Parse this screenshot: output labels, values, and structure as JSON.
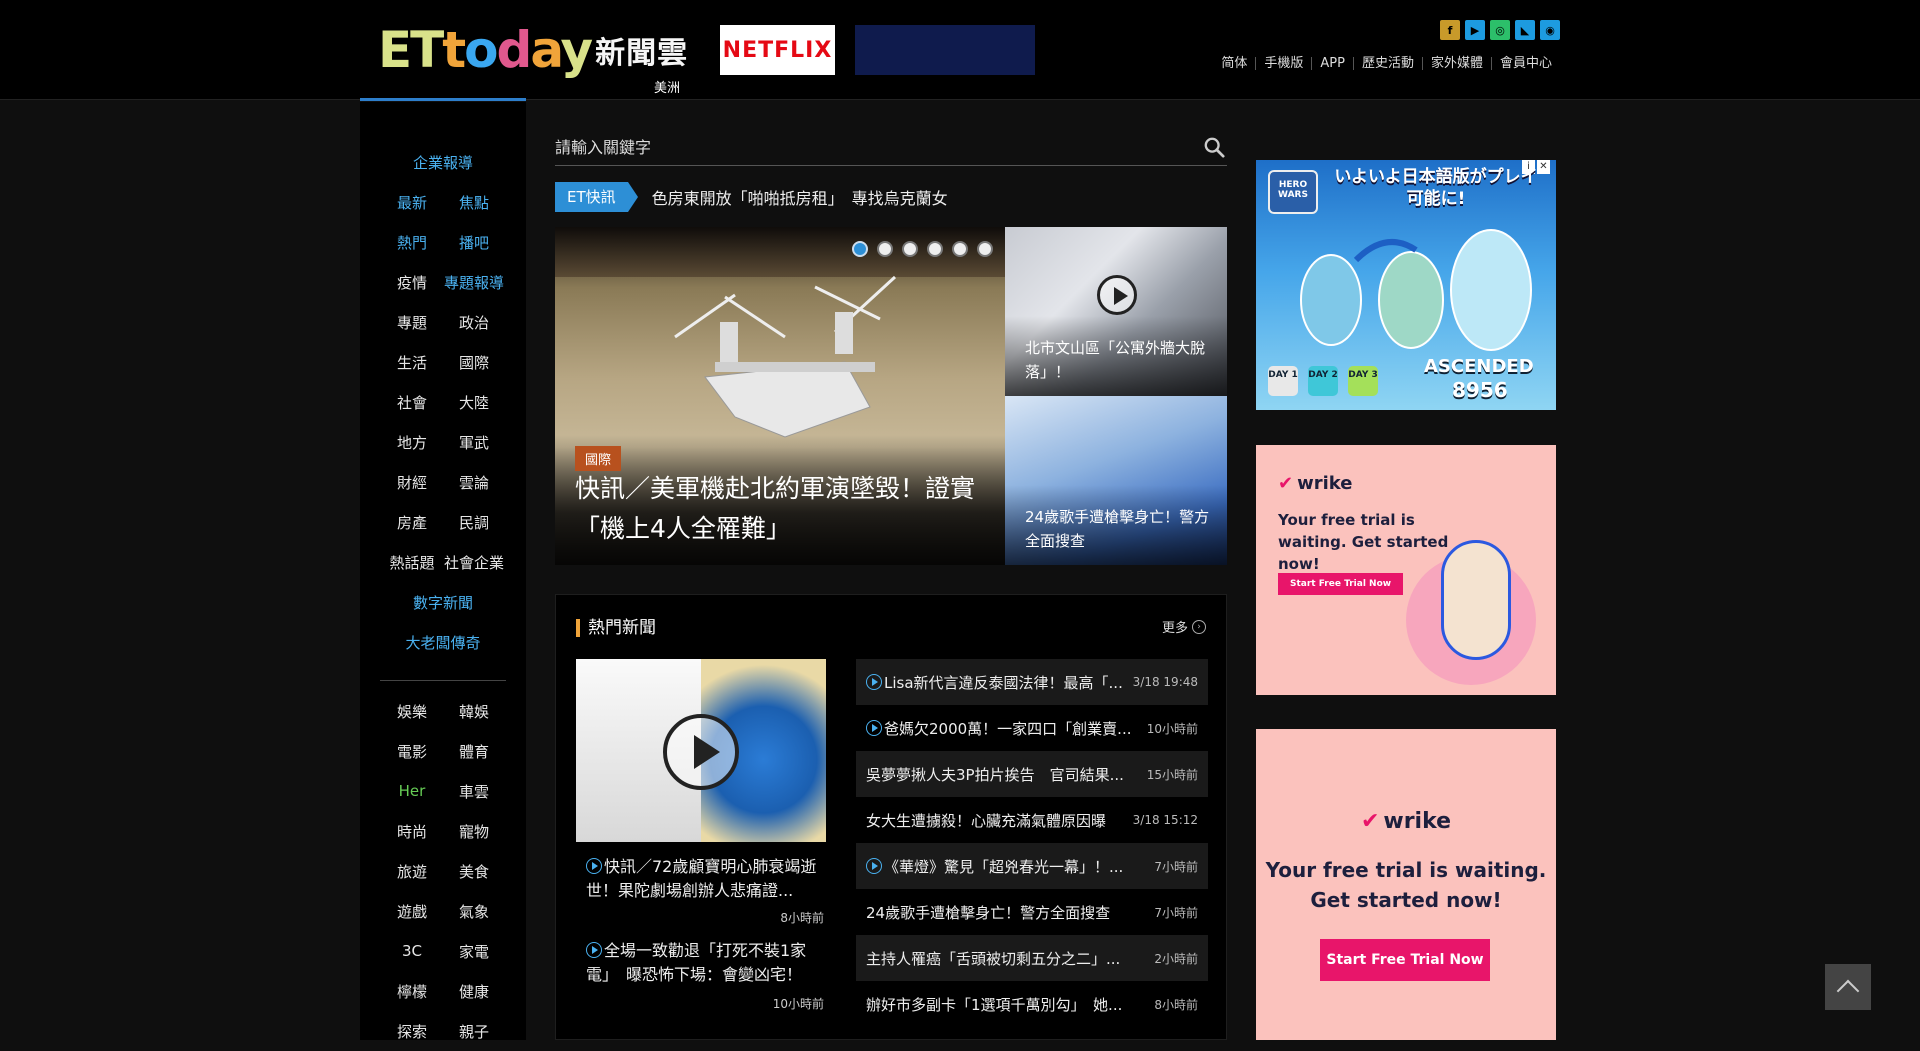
{
  "header": {
    "logo_latin": "ETtoday",
    "logo_cn": "新聞雲",
    "region": "美洲",
    "netflix_label": "NETFLIX",
    "social_icons": [
      "facebook-icon",
      "youtube-icon",
      "instagram-icon",
      "rss-icon",
      "weibo-icon"
    ],
    "topnav": [
      "简体",
      "手機版",
      "APP",
      "歷史活動",
      "家外媒體",
      "會員中心"
    ]
  },
  "leftnav": {
    "rows": [
      [
        {
          "label": "企業報導",
          "color": "blue"
        }
      ],
      [
        {
          "label": "最新",
          "color": "blue"
        },
        {
          "label": "焦點",
          "color": "blue"
        }
      ],
      [
        {
          "label": "熱門",
          "color": "blue"
        },
        {
          "label": "播吧",
          "color": "blue"
        }
      ],
      [
        {
          "label": "疫情",
          "color": "white"
        },
        {
          "label": "專題報導",
          "color": "blue"
        }
      ],
      [
        {
          "label": "專題",
          "color": "white"
        },
        {
          "label": "政治",
          "color": "white"
        }
      ],
      [
        {
          "label": "生活",
          "color": "white"
        },
        {
          "label": "國際",
          "color": "white"
        }
      ],
      [
        {
          "label": "社會",
          "color": "white"
        },
        {
          "label": "大陸",
          "color": "white"
        }
      ],
      [
        {
          "label": "地方",
          "color": "white"
        },
        {
          "label": "軍武",
          "color": "white"
        }
      ],
      [
        {
          "label": "財經",
          "color": "white"
        },
        {
          "label": "雲論",
          "color": "white"
        }
      ],
      [
        {
          "label": "房產",
          "color": "white"
        },
        {
          "label": "民調",
          "color": "white"
        }
      ],
      [
        {
          "label": "熱話題",
          "color": "white"
        },
        {
          "label": "社會企業",
          "color": "white"
        }
      ],
      [
        {
          "label": "數字新聞",
          "color": "blue"
        }
      ],
      [
        {
          "label": "大老闆傳奇",
          "color": "blue"
        }
      ]
    ],
    "rows2": [
      [
        {
          "label": "娛樂",
          "color": "white"
        },
        {
          "label": "韓娛",
          "color": "white"
        }
      ],
      [
        {
          "label": "電影",
          "color": "white"
        },
        {
          "label": "體育",
          "color": "white"
        }
      ],
      [
        {
          "label": "Her",
          "color": "green"
        },
        {
          "label": "車雲",
          "color": "white"
        }
      ],
      [
        {
          "label": "時尚",
          "color": "white"
        },
        {
          "label": "寵物",
          "color": "white"
        }
      ],
      [
        {
          "label": "旅遊",
          "color": "white"
        },
        {
          "label": "美食",
          "color": "white"
        }
      ],
      [
        {
          "label": "遊戲",
          "color": "white"
        },
        {
          "label": "氣象",
          "color": "white"
        }
      ],
      [
        {
          "label": "3C",
          "color": "white"
        },
        {
          "label": "家電",
          "color": "white"
        }
      ],
      [
        {
          "label": "檸檬",
          "color": "white"
        },
        {
          "label": "健康",
          "color": "white"
        }
      ],
      [
        {
          "label": "探索",
          "color": "white"
        },
        {
          "label": "親子",
          "color": "white"
        }
      ]
    ]
  },
  "search": {
    "placeholder": "請輸入關鍵字"
  },
  "ticker": {
    "badge": "ET快訊",
    "text": "色房東開放「啪啪抵房租」　專找烏克蘭女"
  },
  "hero": {
    "category": "國際",
    "title": "快訊／美軍機赴北約軍演墜毀！證實「機上4人全罹難」",
    "slide_count": 6,
    "active_slide": 0
  },
  "side_stories": [
    {
      "title": "北市文山區「公寓外牆大脫落」！"
    },
    {
      "title": "24歲歌手遭槍擊身亡！警方全面搜查"
    }
  ],
  "hot": {
    "heading": "熱門新聞",
    "more": "更多",
    "features": [
      {
        "title": "快訊／72歲顧寶明心肺衰竭逝世！果陀劇場創辦人悲痛證...",
        "time": "8小時前"
      },
      {
        "title": "全場一致勸退「打死不裝1家電」　曝恐怖下場：會變凶宅！",
        "time": "10小時前"
      }
    ],
    "list": [
      {
        "title": "Lisa新代言違反泰國法律！最高「...",
        "time": "3/18 19:48",
        "video": true
      },
      {
        "title": "爸媽欠2000萬！一家四口「創業賣...",
        "time": "10小時前",
        "video": true
      },
      {
        "title": "吳夢夢揪人夫3P拍片挨告　官司結果...",
        "time": "15小時前",
        "video": false
      },
      {
        "title": "女大生遭擄殺！心臟充滿氣體原因曝",
        "time": "3/18 15:12",
        "video": false
      },
      {
        "title": "《華燈》驚見「超兇春光一幕」！...",
        "time": "7小時前",
        "video": true
      },
      {
        "title": "24歲歌手遭槍擊身亡！警方全面搜查",
        "time": "7小時前",
        "video": false
      },
      {
        "title": "主持人罹癌「舌頭被切剩五分之二」...",
        "time": "2小時前",
        "video": false
      },
      {
        "title": "辦好市多副卡「1選項千萬別勾」　她...",
        "time": "8小時前",
        "video": false
      }
    ]
  },
  "ads": {
    "game": {
      "title": "いよいよ日本語版がプレイ可能に!",
      "badge": "HERO WARS",
      "ascended": "ASCENDED",
      "number": "8956",
      "days": [
        "DAY 1",
        "DAY 2",
        "DAY 3"
      ]
    },
    "wrike_small": {
      "brand": "wrike",
      "text": "Your free trial is waiting. Get started now!",
      "button": "Start Free Trial Now"
    },
    "wrike_large": {
      "brand": "wrike",
      "text": "Your free trial is waiting. Get started now!",
      "button": "Start Free Trial Now"
    }
  }
}
